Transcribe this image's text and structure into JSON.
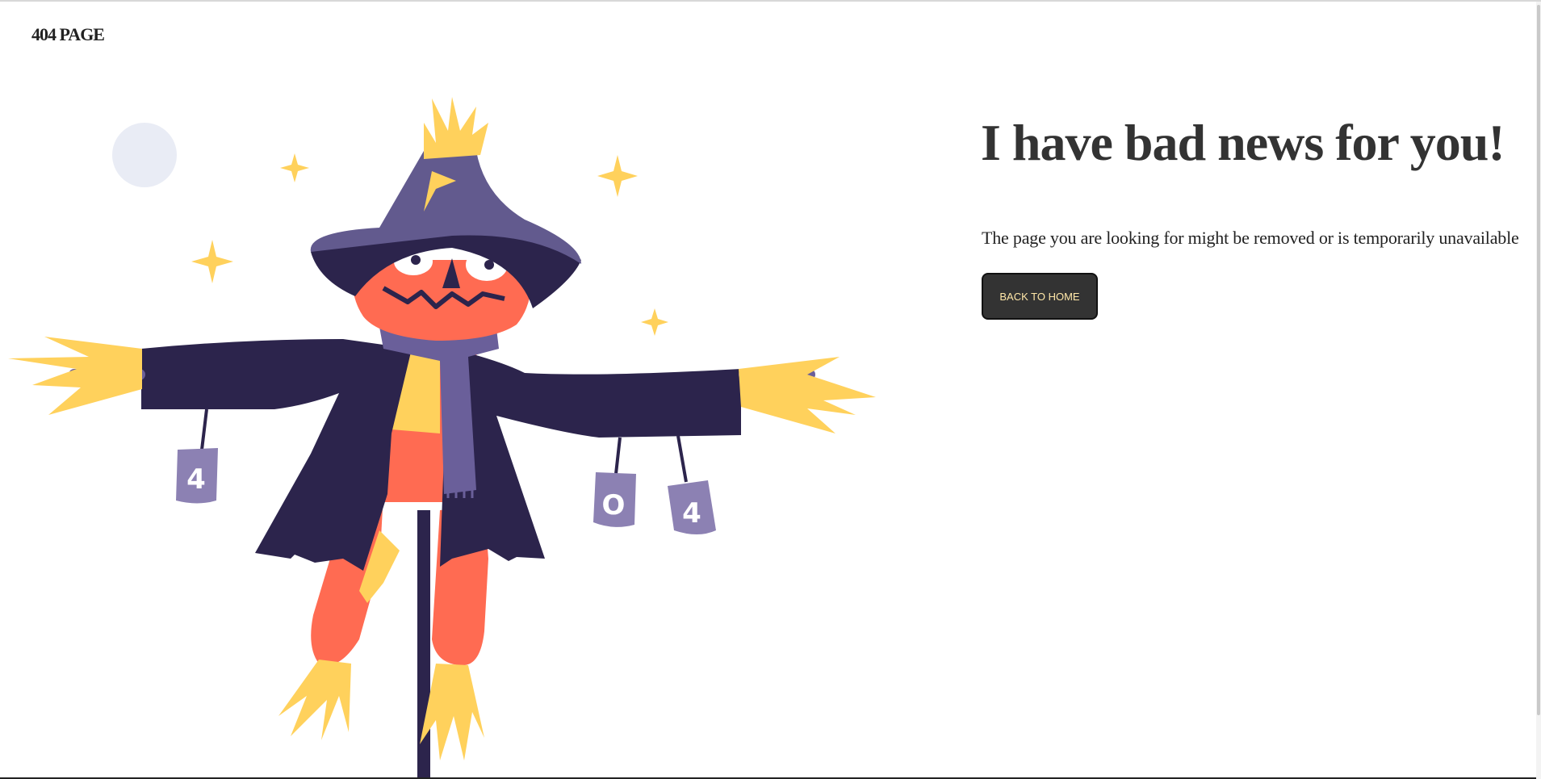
{
  "header": {
    "brand": "404 PAGE"
  },
  "main": {
    "headline": "I have bad news for you!",
    "message": "The page you are looking for might be removed or is temporarily unavailable",
    "button_label": "BACK TO HOME"
  },
  "illustration": {
    "subject": "scarecrow",
    "cans": [
      "4",
      "0",
      "4"
    ],
    "colors": {
      "hat": "#625a8e",
      "coat": "#2c244c",
      "face": "#ff6b52",
      "straw": "#ffd15c",
      "scarf": "#6a5f9a",
      "can": "#8c81b3",
      "moon": "#e9ecf5"
    }
  },
  "colors": {
    "button_bg": "#333333",
    "button_text": "#ffe7a8",
    "heading": "#333333"
  }
}
